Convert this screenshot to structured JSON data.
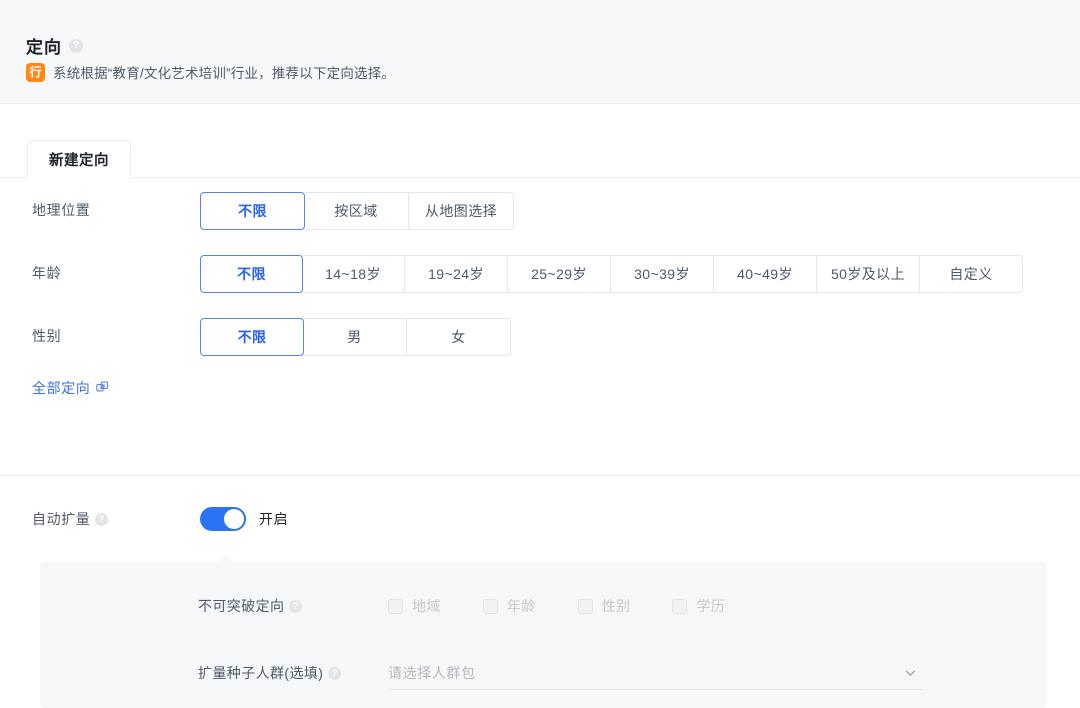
{
  "header": {
    "title": "定向",
    "help_icon": "help-circle-icon",
    "badge": "行",
    "note": "系统根据“教育/文化艺术培训”行业，推荐以下定向选择。"
  },
  "tabs": [
    {
      "label": "新建定向",
      "active": true
    }
  ],
  "form": {
    "rows": [
      {
        "label": "地理位置",
        "options": [
          {
            "label": "不限",
            "selected": true
          },
          {
            "label": "按区域",
            "selected": false
          },
          {
            "label": "从地图选择",
            "selected": false
          }
        ]
      },
      {
        "label": "年龄",
        "options": [
          {
            "label": "不限",
            "selected": true
          },
          {
            "label": "14~18岁",
            "selected": false
          },
          {
            "label": "19~24岁",
            "selected": false
          },
          {
            "label": "25~29岁",
            "selected": false
          },
          {
            "label": "30~39岁",
            "selected": false
          },
          {
            "label": "40~49岁",
            "selected": false
          },
          {
            "label": "50岁及以上",
            "selected": false
          },
          {
            "label": "自定义",
            "selected": false
          }
        ]
      },
      {
        "label": "性别",
        "options": [
          {
            "label": "不限",
            "selected": true
          },
          {
            "label": "男",
            "selected": false
          },
          {
            "label": "女",
            "selected": false
          }
        ]
      }
    ],
    "all_targeting_link": {
      "label": "全部定向",
      "icon": "external-expand-icon"
    }
  },
  "auto_expand": {
    "label": "自动扩量",
    "help_icon": "help-circle-icon",
    "switch_state": "on",
    "switch_text": "开启",
    "no_break": {
      "label": "不可突破定向",
      "help_icon": "help-circle-icon",
      "checkboxes": [
        {
          "label": "地域",
          "checked": false,
          "disabled": true
        },
        {
          "label": "年龄",
          "checked": false,
          "disabled": true
        },
        {
          "label": "性别",
          "checked": false,
          "disabled": true
        },
        {
          "label": "学历",
          "checked": false,
          "disabled": true
        }
      ]
    },
    "seed_crowd": {
      "label": "扩量种子人群(选填)",
      "help_icon": "help-circle-icon",
      "value": "",
      "placeholder": "请选择人群包",
      "chevron_icon": "chevron-down-icon"
    }
  },
  "colors": {
    "accent_blue": "#2a62f0",
    "switch_blue": "#2a74f3",
    "badge_orange": "#ff8816",
    "header_bg": "#f7f8fa",
    "panel_bg": "#f6f7f9",
    "link_blue": "#3a6df0"
  }
}
